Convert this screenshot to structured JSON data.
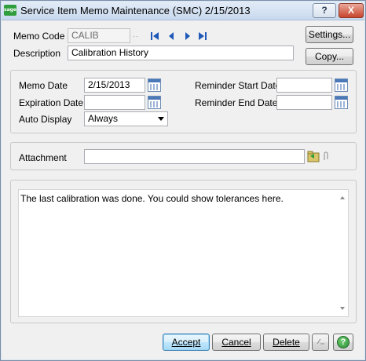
{
  "window": {
    "logo": "sage",
    "title": "Service Item Memo Maintenance (SMC) 2/15/2013",
    "help_label": "?",
    "close_label": "X"
  },
  "header": {
    "memo_code_label": "Memo Code",
    "memo_code_value": "CALIB",
    "description_label": "Description",
    "description_value": "Calibration History",
    "settings_button": "Settings...",
    "copy_button": "Copy...",
    "nav_icons": [
      "first-record-icon",
      "previous-record-icon",
      "next-record-icon",
      "last-record-icon"
    ]
  },
  "dates": {
    "memo_date_label": "Memo Date",
    "memo_date_value": "2/15/2013",
    "expiration_date_label": "Expiration Date",
    "expiration_date_value": "",
    "auto_display_label": "Auto Display",
    "auto_display_value": "Always",
    "reminder_start_label": "Reminder Start Date",
    "reminder_start_value": "",
    "reminder_end_label": "Reminder End Date",
    "reminder_end_value": ""
  },
  "attachment": {
    "label": "Attachment",
    "value": ""
  },
  "memo": {
    "text": "The last calibration was done. You could show tolerances here."
  },
  "footer": {
    "accept": "Accept",
    "cancel": "Cancel",
    "delete": "Delete",
    "help_glyph": "?"
  },
  "colors": {
    "accent": "#3c7fb1",
    "nav_icon": "#1f58b8",
    "help_green": "#2e8b3a",
    "logo_green": "#2e9d3c"
  }
}
